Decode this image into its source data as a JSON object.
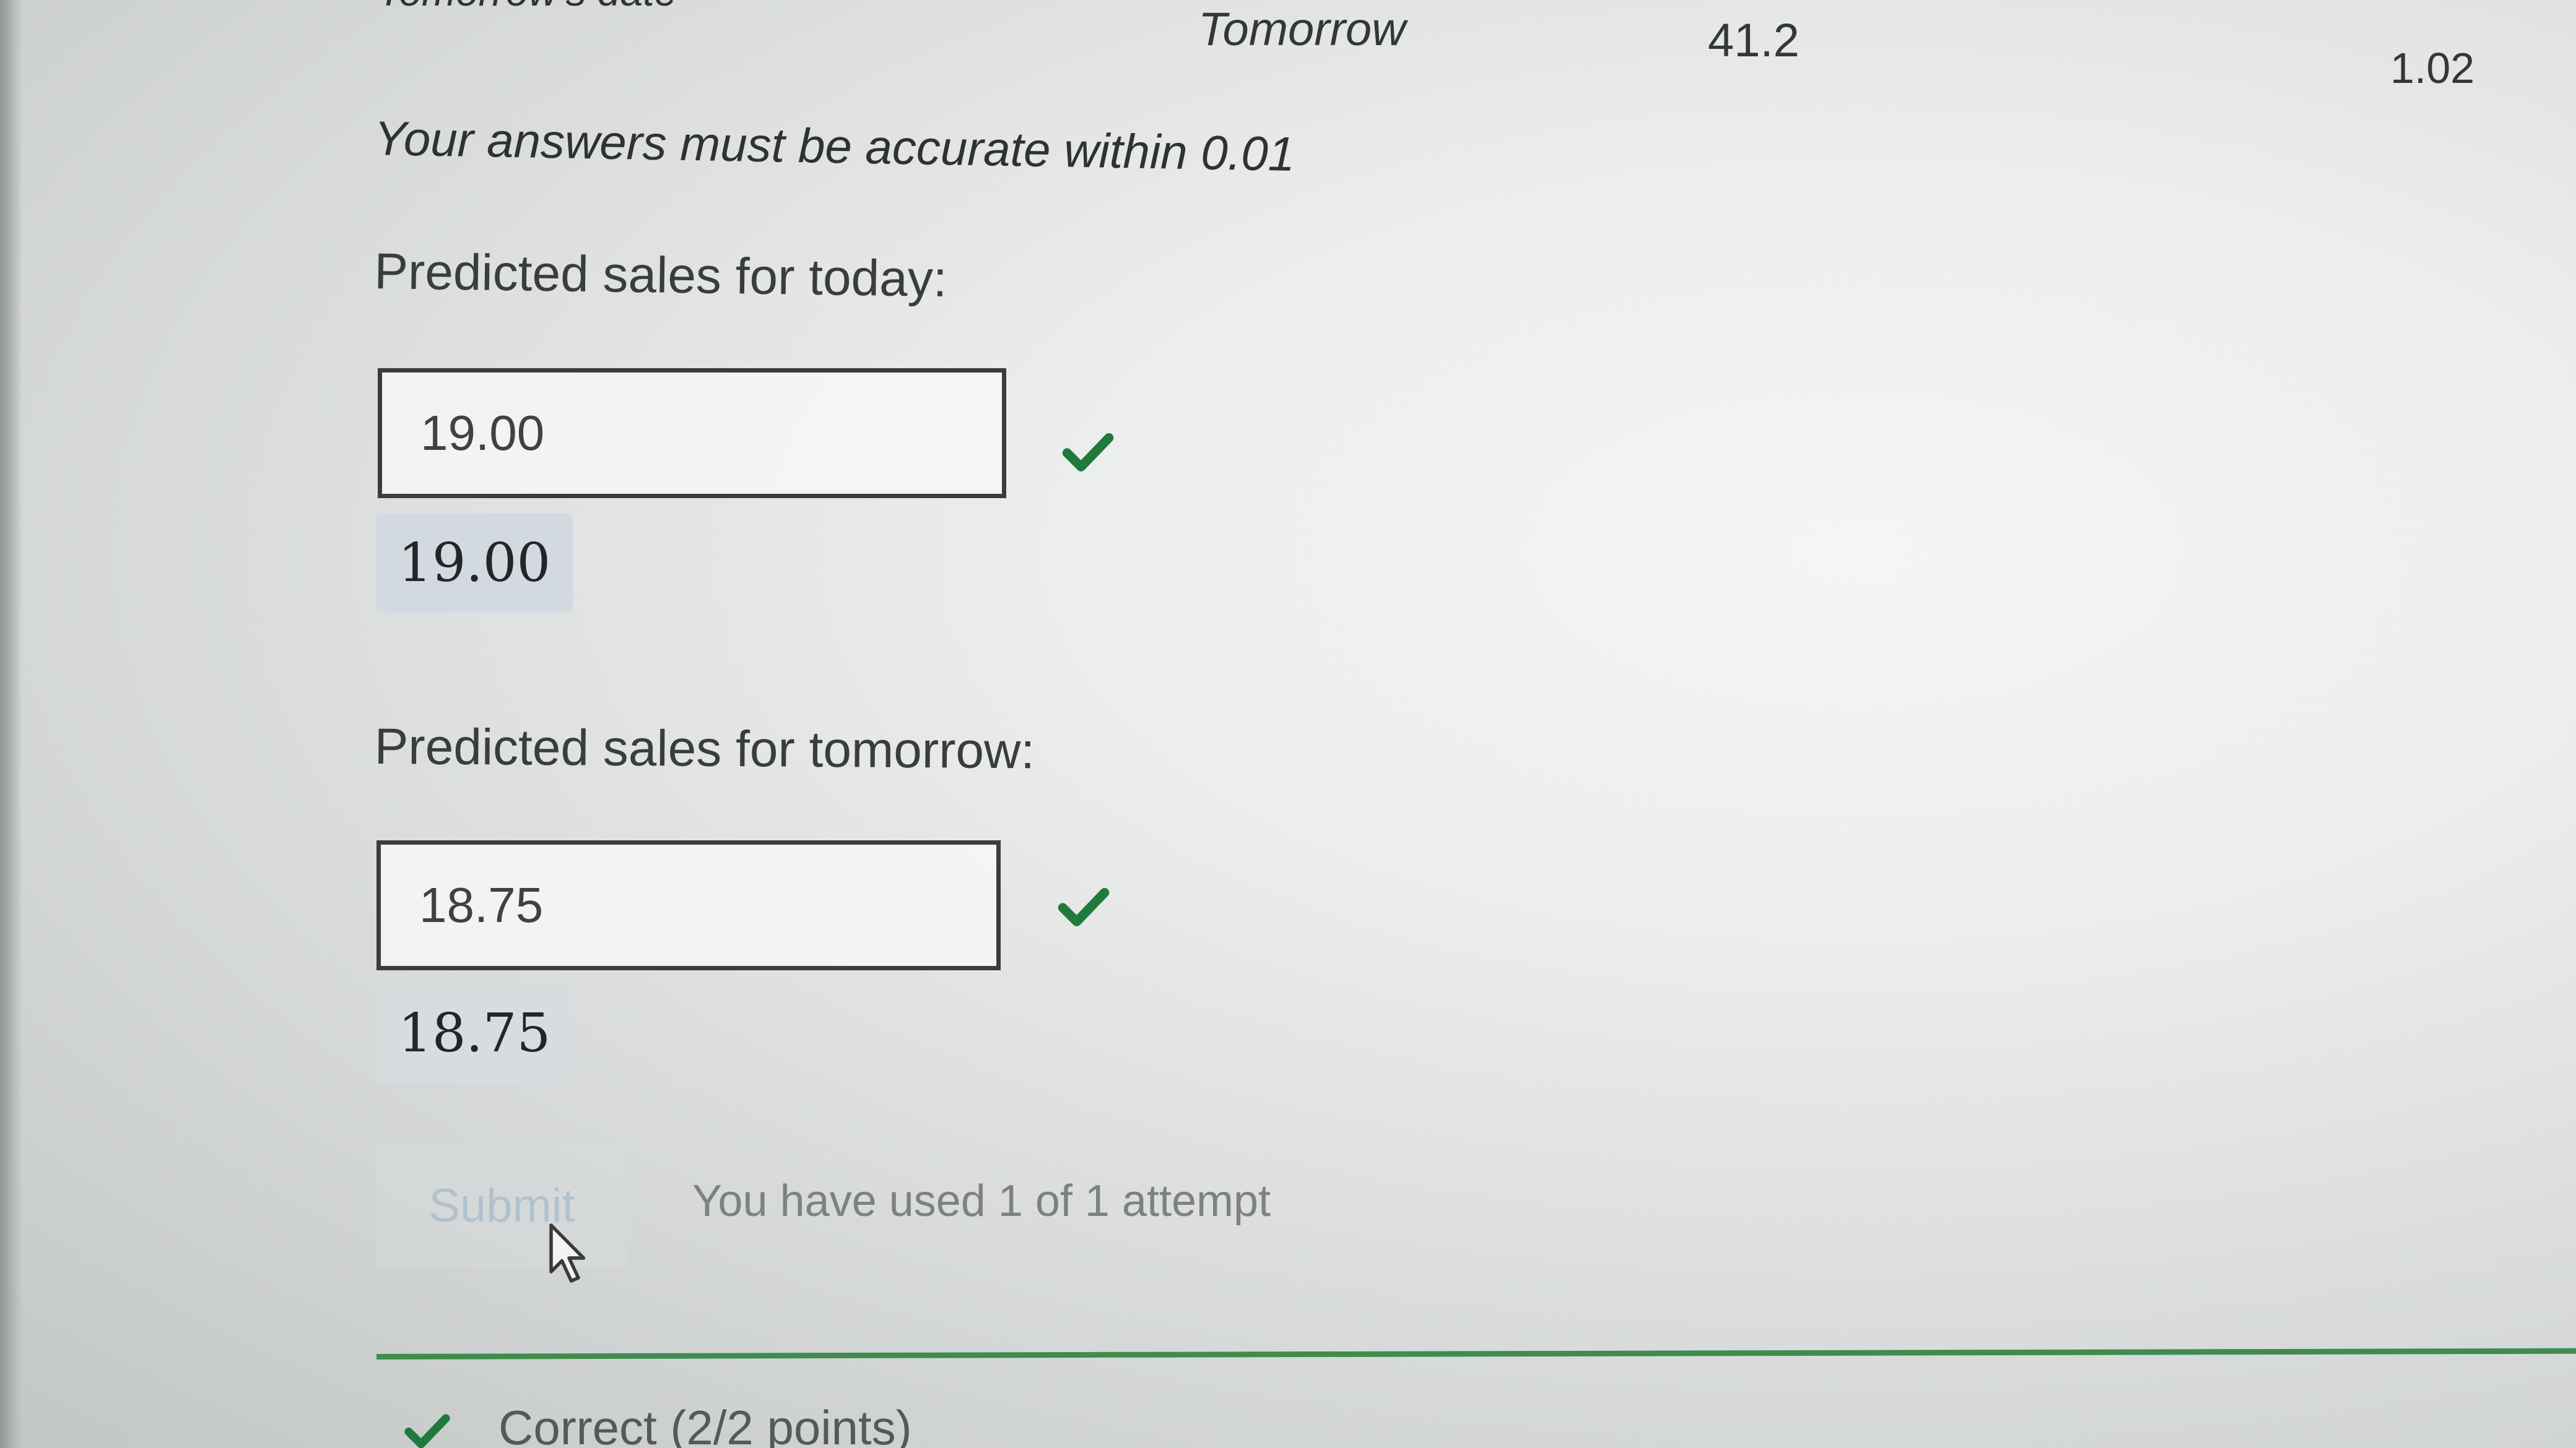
{
  "header": {
    "cut_label": "Tomorrow's date",
    "day_label": "Tomorrow",
    "day_value": "41.2",
    "extra_value": "1.02"
  },
  "instruction": "Your answers must be accurate within 0.01",
  "questions": [
    {
      "label": "Predicted sales for today:",
      "input_value": "19.00",
      "preview": "19.00",
      "status_icon": "check-icon"
    },
    {
      "label": "Predicted sales for tomorrow:",
      "input_value": "18.75",
      "preview": "18.75",
      "status_icon": "check-icon"
    }
  ],
  "submit": {
    "label": "Submit",
    "attempts_text": "You have used 1 of 1 attempt"
  },
  "result": {
    "text": "Correct (2/2 points)",
    "icon": "check-icon"
  },
  "colors": {
    "correct_green": "#1f7a3c",
    "divider_green": "#3f8c4e",
    "disabled_text": "#b2c2cc"
  }
}
